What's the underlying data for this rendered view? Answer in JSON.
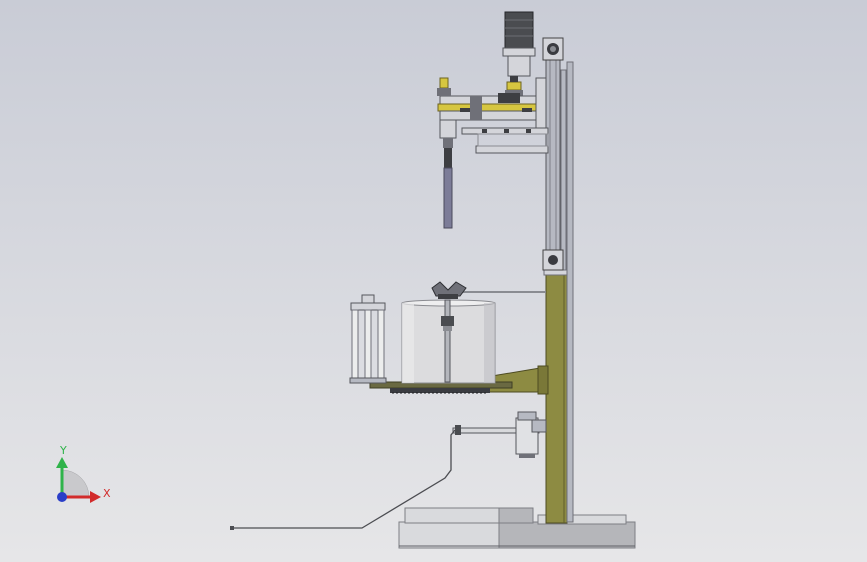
{
  "viewport": {
    "background_top": "#c9ccd6",
    "background_bottom": "#e6e6e8"
  },
  "triad": {
    "y_label": "Y",
    "x_label": "X",
    "y_color": "#2fb34a",
    "x_color": "#d22b2b",
    "z_color": "#2a3ec8"
  },
  "colors": {
    "frame_olive": "#8d8b42",
    "rail_grey": "#b6b9c2",
    "steel_light": "#d4d5da",
    "steel_dark": "#6f7078",
    "drum": "#dcdcde",
    "yellow_part": "#d6c640",
    "motor_dark": "#4a4c50",
    "base_light": "#d9dadd",
    "base_dark": "#b5b6ba"
  }
}
